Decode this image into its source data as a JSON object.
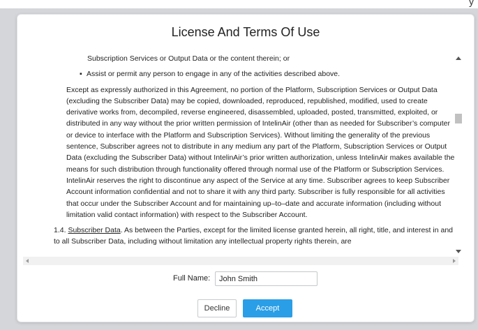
{
  "dialog": {
    "title": "License And Terms Of Use",
    "content": {
      "cont_line": "Subscription Services or Output Data or the content therein; or",
      "bullet": "Assist or permit any person to engage in any of the activities described above.",
      "main_paragraph": "Except as expressly authorized in this Agreement, no portion of the Platform, Subscription Services or Output Data (excluding the Subscriber Data) may be copied, downloaded, reproduced, republished, modified, used to create derivative works from, decompiled, reverse engineered, disassembled, uploaded, posted, transmitted, exploited, or distributed in any way without the prior written permission of IntelinAir (other than as needed for Subscriber’s computer or device to interface with the Platform and Subscription Services). Without limiting the generality of the previous sentence, Subscriber agrees not to distribute in any medium any part of the Platform, Subscription Services or Output Data (excluding the Subscriber Data) without IntelinAir’s prior written authorization, unless IntelinAir makes available the means for such distribution through functionality offered through normal use of the Platform or Subscription Services. IntelinAir reserves the right to discontinue any aspect of the Service at any time. Subscriber agrees to keep Subscriber Account information confidential and not to share it with any third party. Subscriber is fully responsible for all activities that occur under the Subscriber Account and for maintaining up–to–date and accurate information (including without limitation valid contact information) with respect to the Subscriber Account.",
      "section_number": "1.4.",
      "section_title": "Subscriber Data",
      "section_text": ". As between the Parties, except for the limited license granted herein, all right, title, and interest in and to all Subscriber Data, including without limitation any intellectual property rights therein, are"
    },
    "form": {
      "full_name_label": "Full Name:",
      "full_name_value": "John Smith"
    },
    "buttons": {
      "decline": "Decline",
      "accept": "Accept"
    }
  },
  "colors": {
    "accent": "#2a9ee6",
    "backdrop": "#d4d6d9"
  }
}
